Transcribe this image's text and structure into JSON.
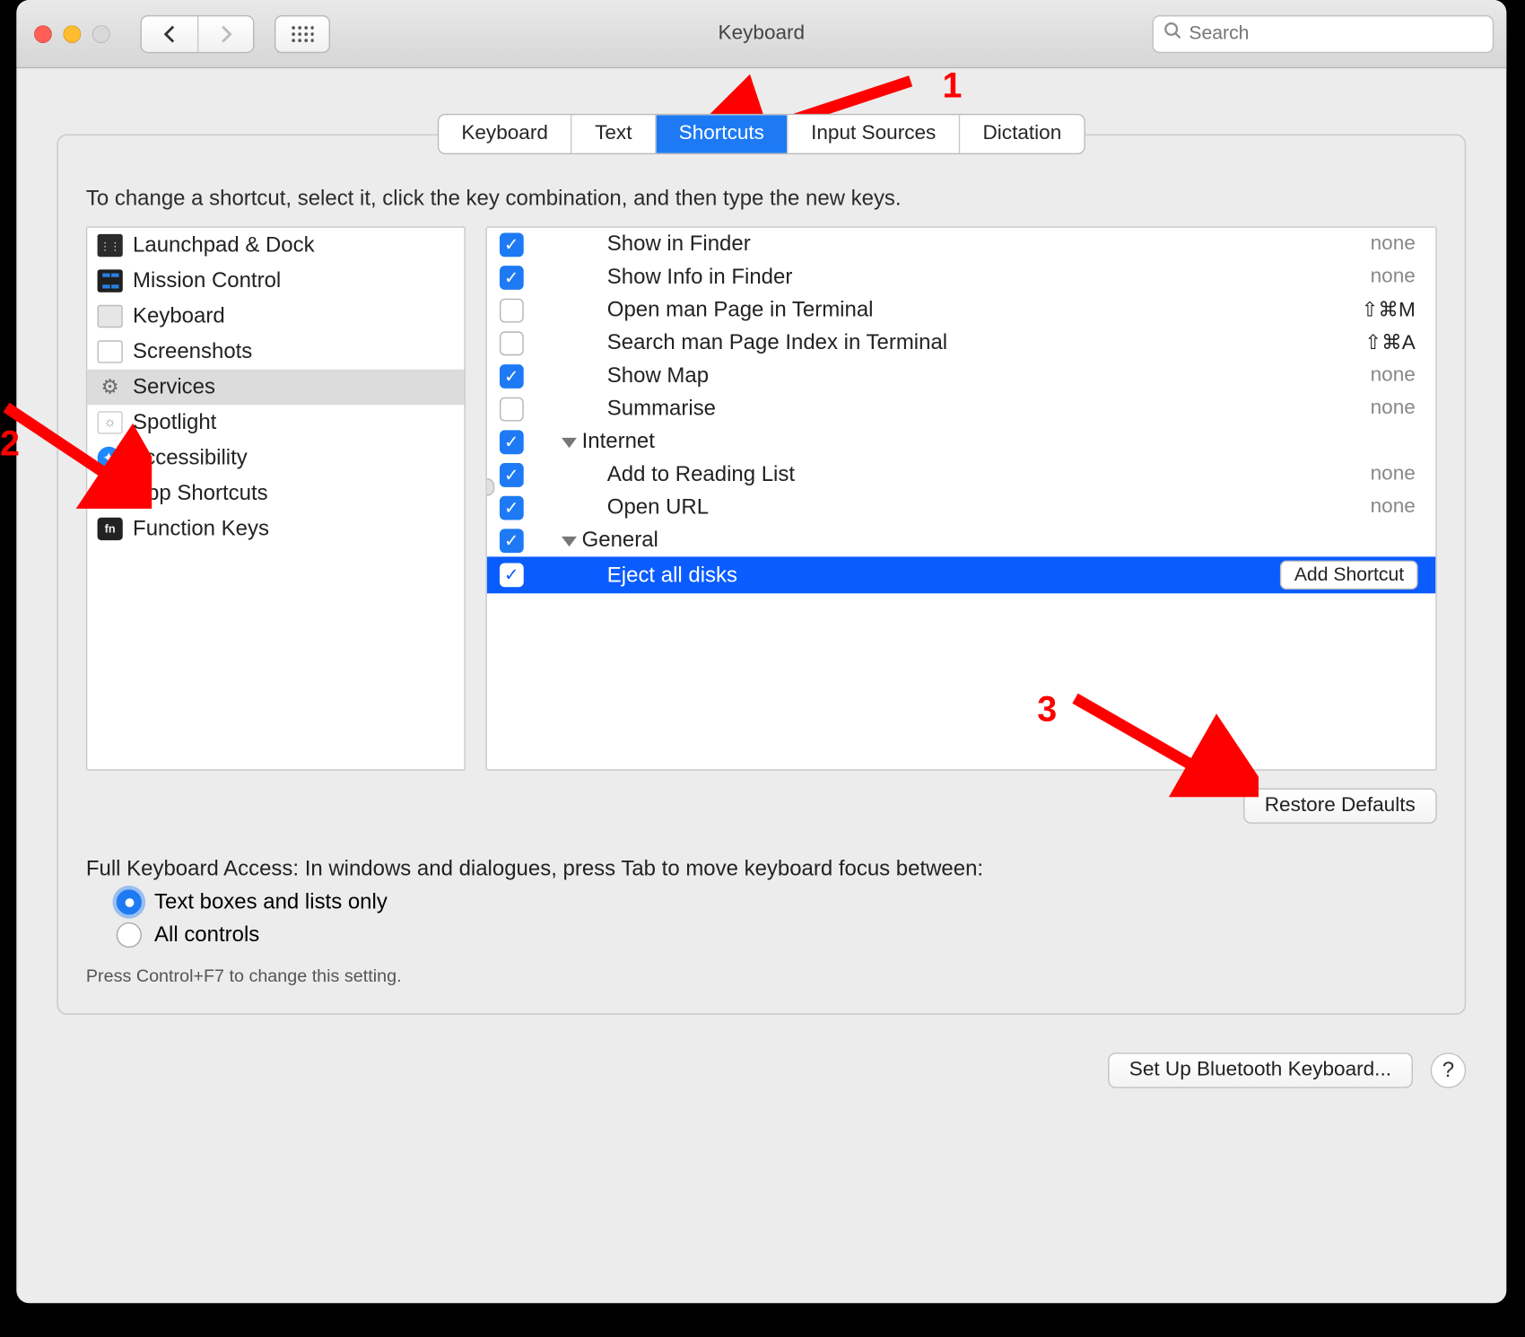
{
  "window": {
    "title": "Keyboard"
  },
  "search": {
    "placeholder": "Search"
  },
  "tabs": {
    "keyboard": "Keyboard",
    "text": "Text",
    "shortcuts": "Shortcuts",
    "input_sources": "Input Sources",
    "dictation": "Dictation"
  },
  "instruction": "To change a shortcut, select it, click the key combination, and then type the new keys.",
  "sidebar": [
    "Launchpad & Dock",
    "Mission Control",
    "Keyboard",
    "Screenshots",
    "Services",
    "Spotlight",
    "Accessibility",
    "App Shortcuts",
    "Function Keys"
  ],
  "services": {
    "rows": [
      {
        "label": "Show in Finder",
        "checked": true,
        "indent": 2,
        "shortcut": "none",
        "sc_style": "text"
      },
      {
        "label": "Show Info in Finder",
        "checked": true,
        "indent": 2,
        "shortcut": "none",
        "sc_style": "text"
      },
      {
        "label": "Open man Page in Terminal",
        "checked": false,
        "indent": 2,
        "shortcut": "⇧⌘M",
        "sc_style": "sym"
      },
      {
        "label": "Search man Page Index in Terminal",
        "checked": false,
        "indent": 2,
        "shortcut": "⇧⌘A",
        "sc_style": "sym"
      },
      {
        "label": "Show Map",
        "checked": true,
        "indent": 2,
        "shortcut": "none",
        "sc_style": "text"
      },
      {
        "label": "Summarise",
        "checked": false,
        "indent": 2,
        "shortcut": "none",
        "sc_style": "text"
      },
      {
        "label": "Internet",
        "checked": true,
        "indent": 1,
        "group": true
      },
      {
        "label": "Add to Reading List",
        "checked": true,
        "indent": 2,
        "shortcut": "none",
        "sc_style": "text"
      },
      {
        "label": "Open URL",
        "checked": true,
        "indent": 2,
        "shortcut": "none",
        "sc_style": "text"
      },
      {
        "label": "General",
        "checked": true,
        "indent": 1,
        "group": true
      },
      {
        "label": "Eject all disks",
        "checked": true,
        "indent": 2,
        "selected": true,
        "shortcut_button": "Add Shortcut"
      }
    ]
  },
  "restore_defaults": "Restore Defaults",
  "full_access": {
    "label": "Full Keyboard Access: In windows and dialogues, press Tab to move keyboard focus between:",
    "opt1": "Text boxes and lists only",
    "opt2": "All controls",
    "hint": "Press Control+F7 to change this setting."
  },
  "bluetooth_btn": "Set Up Bluetooth Keyboard...",
  "help_btn": "?",
  "annotations": {
    "n1": "1",
    "n2": "2",
    "n3": "3"
  }
}
